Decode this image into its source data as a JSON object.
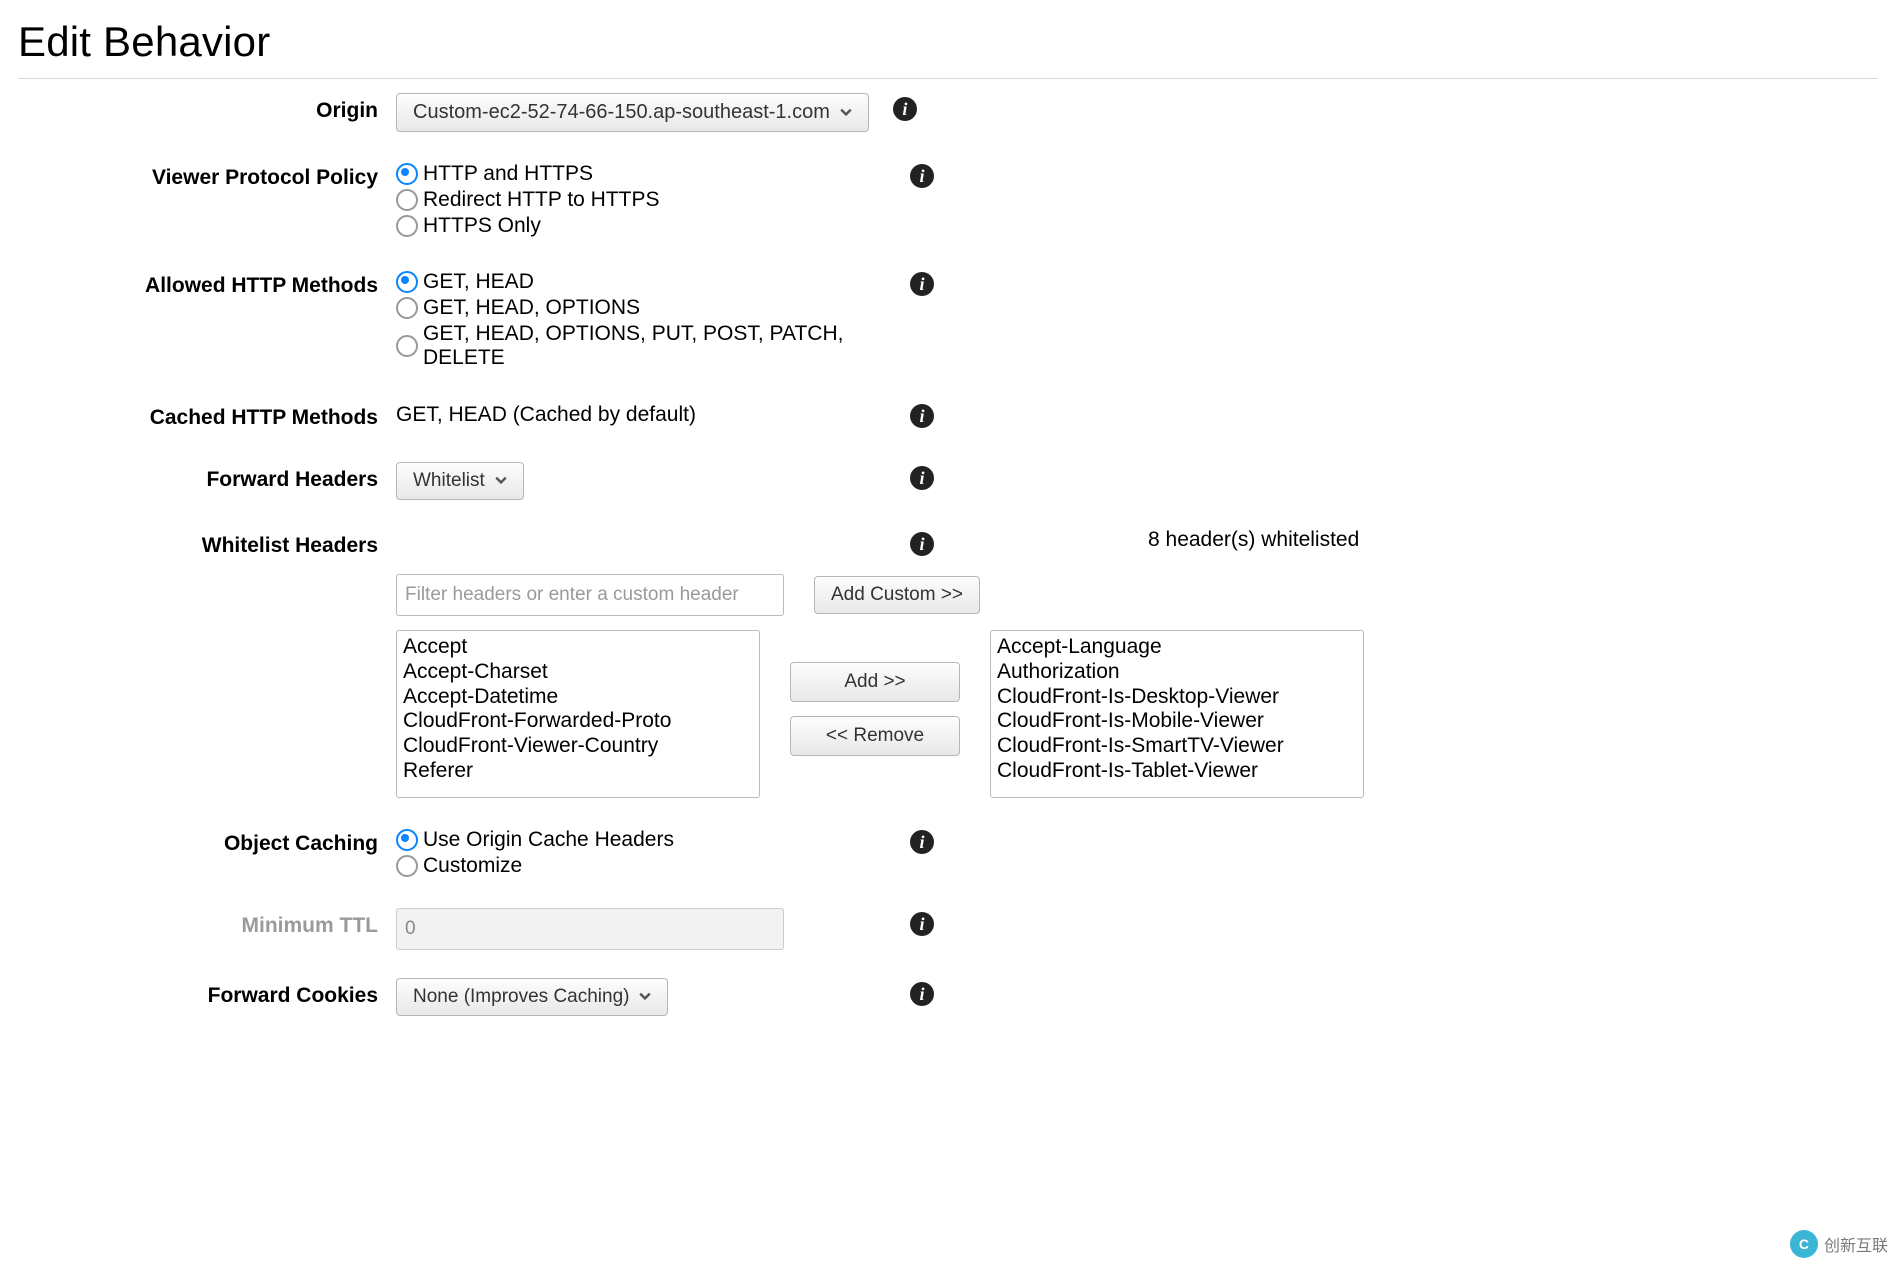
{
  "title": "Edit Behavior",
  "origin": {
    "label": "Origin",
    "selected": "Custom-ec2-52-74-66-150.ap-southeast-1.com"
  },
  "viewer_protocol": {
    "label": "Viewer Protocol Policy",
    "options": [
      {
        "label": "HTTP and HTTPS",
        "selected": true
      },
      {
        "label": "Redirect HTTP to HTTPS",
        "selected": false
      },
      {
        "label": "HTTPS Only",
        "selected": false
      }
    ]
  },
  "allowed_methods": {
    "label": "Allowed HTTP Methods",
    "options": [
      {
        "label": "GET, HEAD",
        "selected": true
      },
      {
        "label": "GET, HEAD, OPTIONS",
        "selected": false
      },
      {
        "label": "GET, HEAD, OPTIONS, PUT, POST, PATCH, DELETE",
        "selected": false
      }
    ]
  },
  "cached_methods": {
    "label": "Cached HTTP Methods",
    "text": "GET, HEAD (Cached by default)"
  },
  "forward_headers": {
    "label": "Forward Headers",
    "selected": "Whitelist"
  },
  "whitelist_headers": {
    "label": "Whitelist Headers",
    "filter_placeholder": "Filter headers or enter a custom header",
    "add_custom_btn": "Add Custom >>",
    "add_btn": "Add >>",
    "remove_btn": "<< Remove",
    "status": "8 header(s) whitelisted",
    "available": [
      "Accept",
      "Accept-Charset",
      "Accept-Datetime",
      "CloudFront-Forwarded-Proto",
      "CloudFront-Viewer-Country",
      "Referer"
    ],
    "selected": [
      "Accept-Language",
      "Authorization",
      "CloudFront-Is-Desktop-Viewer",
      "CloudFront-Is-Mobile-Viewer",
      "CloudFront-Is-SmartTV-Viewer",
      "CloudFront-Is-Tablet-Viewer"
    ]
  },
  "object_caching": {
    "label": "Object Caching",
    "options": [
      {
        "label": "Use Origin Cache Headers",
        "selected": true
      },
      {
        "label": "Customize",
        "selected": false
      }
    ]
  },
  "min_ttl": {
    "label": "Minimum TTL",
    "value": "0"
  },
  "forward_cookies": {
    "label": "Forward Cookies",
    "selected": "None (Improves Caching)"
  },
  "watermark": {
    "badge": "C",
    "text": "创新互联"
  }
}
